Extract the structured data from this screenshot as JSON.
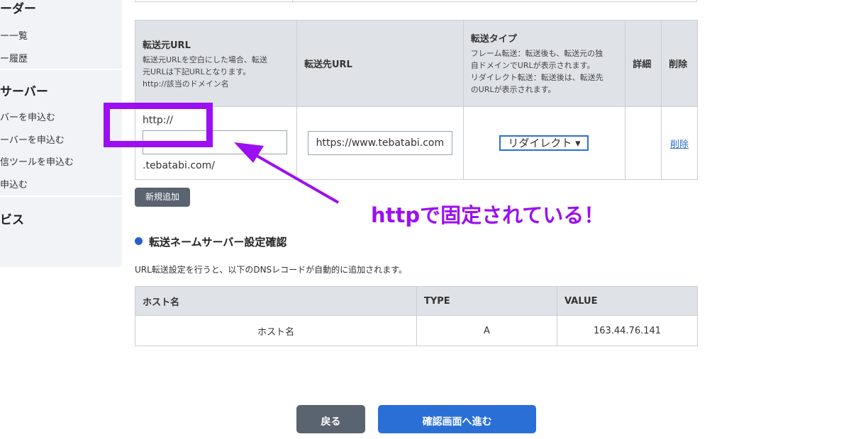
{
  "sidebar": {
    "sections": [
      {
        "heading": "ーダー",
        "links": [
          "ー一覧",
          "ー履歴"
        ]
      },
      {
        "heading": "サーバー",
        "links": [
          "バーを申込む",
          "ーバーを申込む",
          "信ツールを申込む",
          "申込む"
        ]
      },
      {
        "heading": "ビス",
        "links": []
      }
    ]
  },
  "forwarding_table": {
    "headers": {
      "source_title": "転送元URL",
      "source_note": "転送元URLを空白にした場合、転送元URLは下記URLとなります。http://該当のドメイン名",
      "source_note_lines": [
        "転送元URLを空白にした場合、転送",
        "元URLは下記URLとなります。",
        "http://該当のドメイン名"
      ],
      "dest": "転送先URL",
      "type_title": "転送タイプ",
      "type_note_lines": [
        "フレーム転送：転送後も、転送元の独",
        "自ドメインでURLが表示されます。",
        "リダイレクト転送：転送後は、転送先",
        "のURLが表示されます。"
      ],
      "detail": "詳細",
      "delete": "削除"
    },
    "row": {
      "source_prefix": "http://",
      "source_value": "",
      "source_suffix": ".tebatabi.com/",
      "dest_value": "https://www.tebatabi.com",
      "type_selected": "リダイレクト ▾",
      "detail": "",
      "delete_link": "削除"
    }
  },
  "new_button": "新規追加",
  "dns_section": {
    "title": "転送ネームサーバー設定確認",
    "description": "URL転送設定を行うと、以下のDNSレコードが自動的に追加されます。",
    "columns": [
      "ホスト名",
      "TYPE",
      "VALUE"
    ],
    "rows": [
      {
        "host": "ホスト名",
        "type": "A",
        "value": "163.44.76.141"
      }
    ]
  },
  "footer_buttons": {
    "back": "戻る",
    "confirm": "確認画面へ進む"
  },
  "annotation": {
    "text": "httpで固定されている！",
    "color": "#9b0ff2"
  },
  "colors": {
    "accent_blue": "#2a6fd6",
    "header_gray": "#dfe3e8",
    "button_gray": "#5a6470"
  }
}
